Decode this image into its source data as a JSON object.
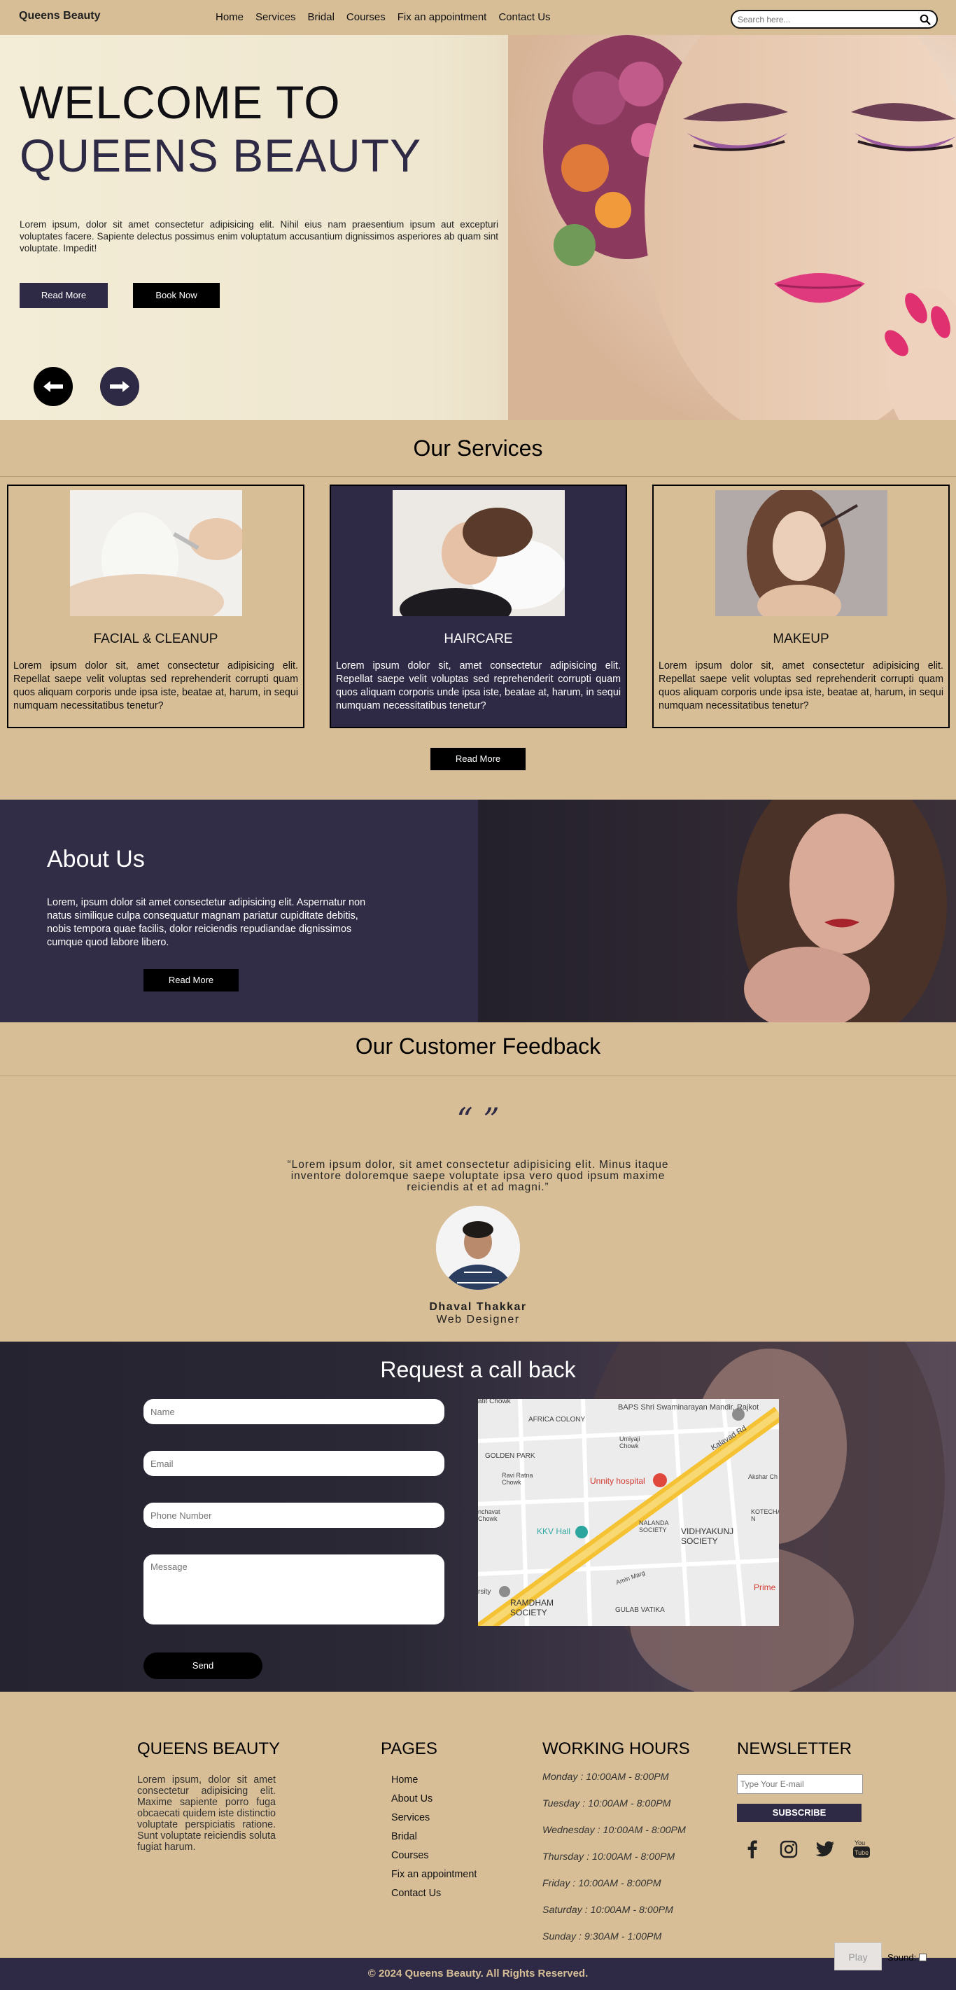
{
  "nav": {
    "brand": "Queens Beauty",
    "links": [
      "Home",
      "Services",
      "Bridal",
      "Courses",
      "Fix an appointment",
      "Contact Us"
    ],
    "search_placeholder": "Search here..."
  },
  "hero": {
    "title_line1": "WELCOME TO",
    "title_line2": "QUEENS BEAUTY",
    "text": "Lorem ipsum, dolor sit amet consectetur adipisicing elit. Nihil eius nam praesentium ipsum aut excepturi voluptates facere. Sapiente delectus possimus enim voluptatum accusantium dignissimos asperiores ab quam sint voluptate. Impedit!",
    "btn_read_more": "Read More",
    "btn_book_now": "Book Now"
  },
  "services": {
    "title": "Our Services",
    "cards": [
      {
        "title": "FACIAL & CLEANUP",
        "text": "Lorem ipsum dolor sit, amet consectetur adipisicing elit. Repellat saepe velit voluptas sed reprehenderit corrupti quam quos aliquam corporis unde ipsa iste, beatae at, harum, in sequi numquam necessitatibus tenetur?"
      },
      {
        "title": "HAIRCARE",
        "text": "Lorem ipsum dolor sit, amet consectetur adipisicing elit. Repellat saepe velit voluptas sed reprehenderit corrupti quam quos aliquam corporis unde ipsa iste, beatae at, harum, in sequi numquam necessitatibus tenetur?"
      },
      {
        "title": "MAKEUP",
        "text": "Lorem ipsum dolor sit, amet consectetur adipisicing elit. Repellat saepe velit voluptas sed reprehenderit corrupti quam quos aliquam corporis unde ipsa iste, beatae at, harum, in sequi numquam necessitatibus tenetur?"
      }
    ],
    "btn": "Read More"
  },
  "about": {
    "title": "About Us",
    "text": "Lorem, ipsum dolor sit amet consectetur adipisicing elit. Aspernatur non natus similique culpa consequatur magnam pariatur cupiditate debitis, nobis tempora quae facilis, dolor reiciendis repudiandae dignissimos cumque quod labore libero.",
    "btn": "Read More"
  },
  "feedback": {
    "title": "Our Customer Feedback",
    "quote_mark": "“ ”",
    "quote": "“Lorem ipsum dolor, sit amet consectetur adipisicing elit. Minus itaque inventore doloremque saepe voluptate ipsa vero quod ipsum maxime reiciendis at et ad magni.”",
    "name": "Dhaval Thakkar",
    "role": "Web Designer"
  },
  "callback": {
    "title": "Request a call back",
    "name_placeholder": "Name",
    "email_placeholder": "Email",
    "phone_placeholder": "Phone Number",
    "message_placeholder": "Message",
    "send": "Send",
    "map_labels": {
      "baps": "BAPS Shri Swaminarayan Mandir, Rajkot",
      "africa": "AFRICA COLONY",
      "golden": "GOLDEN PARK",
      "umiya": "Umiyaji Chowk",
      "ravi": "Ravi Ratna Chowk",
      "kalavad": "Kalavad Rd",
      "unity": "Unnity hospital",
      "akshar": "Akshar Ch",
      "kotecha": "KOTECHA N",
      "kkv": "KKV Hall",
      "nalanda": "NALANDA SOCIETY",
      "vidhyakunj": "VIDHYAKUNJ SOCIETY",
      "ramdham": "RAMDHAM SOCIETY",
      "gulab": "GULAB VATIKA",
      "amin": "Amin Marg",
      "prime": "Prime",
      "mahatit": "atit Chowk",
      "nachavat": "nchavat Chowk",
      "rsity": "rsity"
    }
  },
  "footer": {
    "brand_title": "QUEENS BEAUTY",
    "brand_text": "Lorem ipsum, dolor sit amet consectetur adipisicing elit. Maxime sapiente porro fuga obcaecati quidem iste distinctio voluptate perspiciatis ratione. Sunt voluptate reiciendis soluta fugiat harum.",
    "pages_title": "PAGES",
    "pages": [
      "Home",
      "About Us",
      "Services",
      "Bridal",
      "Courses",
      "Fix an appointment",
      "Contact Us"
    ],
    "hours_title": "WORKING HOURS",
    "hours": [
      "Monday : 10:00AM - 8:00PM",
      "Tuesday : 10:00AM - 8:00PM",
      "Wednesday : 10:00AM - 8:00PM",
      "Thursday : 10:00AM - 8:00PM",
      "Friday : 10:00AM - 8:00PM",
      "Saturday : 10:00AM - 8:00PM",
      "Sunday : 9:30AM - 1:00PM"
    ],
    "newsletter_title": "NEWSLETTER",
    "newsletter_placeholder": "Type Your E-mail",
    "subscribe": "SUBSCRIBE",
    "copyright": "© 2024 Queens Beauty. All Rights Reserved.",
    "play": "Play",
    "sound": "Sound:"
  },
  "colors": {
    "beige": "#d7be96",
    "navy": "#2e2a45",
    "black": "#000000"
  }
}
